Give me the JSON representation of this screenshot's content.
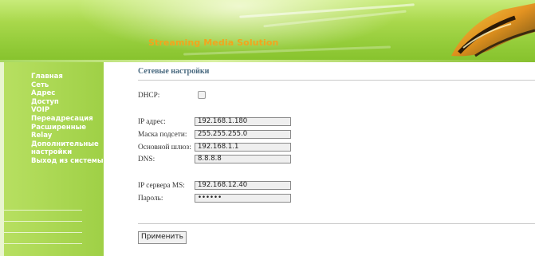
{
  "header": {
    "brand": "Streaming Media Solution"
  },
  "sidebar": {
    "items": [
      {
        "label": "Главная"
      },
      {
        "label": "Сеть"
      },
      {
        "label": "Адрес"
      },
      {
        "label": "Доступ"
      },
      {
        "label": "VOIP"
      },
      {
        "label": "Переадресация"
      },
      {
        "label": "Расширенные"
      },
      {
        "label": "Relay"
      },
      {
        "label": "Дополнительные настройки"
      },
      {
        "label": "Выход из системы"
      }
    ]
  },
  "main": {
    "title": "Сетевые настройки",
    "dhcp": {
      "label": "DHCP:",
      "checked": false
    },
    "ip": {
      "label": "IP адрес:",
      "value": "192.168.1.180"
    },
    "mask": {
      "label": "Маска подсети:",
      "value": "255.255.255.0"
    },
    "gateway": {
      "label": "Основной шлюз:",
      "value": "192.168.1.1"
    },
    "dns": {
      "label": "DNS:",
      "value": "8.8.8.8"
    },
    "ms_server": {
      "label": "IP сервера MS:",
      "value": "192.168.12.40"
    },
    "password": {
      "label": "Пароль:",
      "value": "••••••"
    },
    "apply_label": "Применить"
  },
  "colors": {
    "brand_text": "#f2a51d",
    "green_primary": "#9fd046",
    "title_text": "#4a6a80"
  }
}
